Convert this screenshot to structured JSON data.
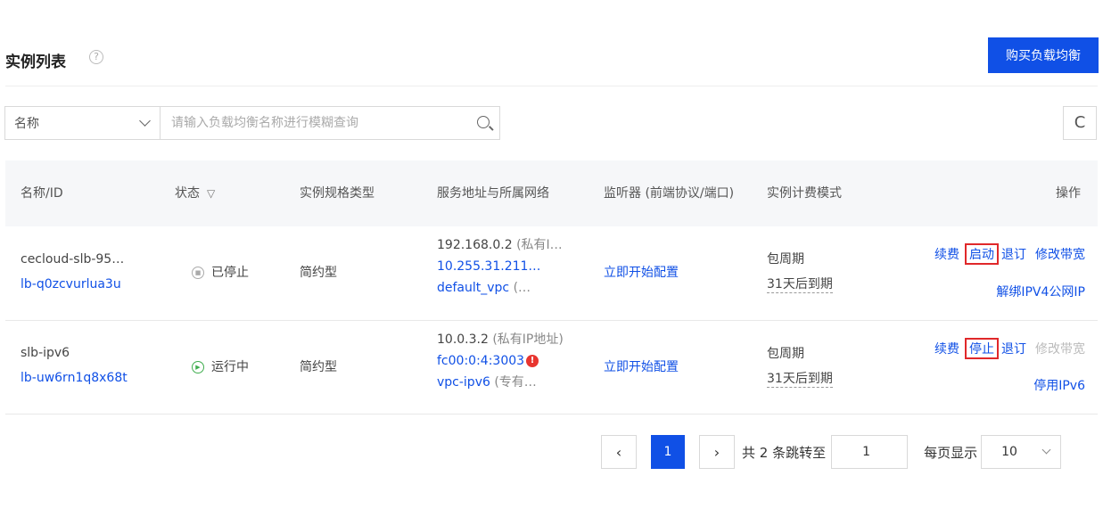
{
  "header": {
    "title": "实例列表",
    "help_icon": "?",
    "buy_button": "购买负载均衡"
  },
  "filter": {
    "select_value": "名称",
    "search_placeholder": "请输入负载均衡名称进行模糊查询",
    "refresh_icon": "C"
  },
  "table": {
    "columns": {
      "name": "名称/ID",
      "status": "状态",
      "spec": "实例规格类型",
      "address": "服务地址与所属网络",
      "listener": "监听器 (前端协议/端口)",
      "billing": "实例计费模式",
      "ops": "操作"
    },
    "rows": [
      {
        "name": "cecloud-slb-95…",
        "id": "lb-q0zcvurlua3u",
        "status": "已停止",
        "spec": "简约型",
        "addr1_ip": "192.168.0.2",
        "addr1_note": "(私有I…",
        "addr2_ip": "10.255.31.211…",
        "addr3_vpc": "default_vpc",
        "addr3_note": "(…",
        "listener": "立即开始配置",
        "billing": "包周期",
        "expiry": "31天后到期",
        "op_renew": "续费",
        "op_toggle": "启动",
        "op_unsubscribe": "退订",
        "op_bandwidth": "修改带宽",
        "op_extra": "解绑IPV4公网IP"
      },
      {
        "name": "slb-ipv6",
        "id": "lb-uw6rn1q8x68t",
        "status": "运行中",
        "spec": "简约型",
        "addr1_ip": "10.0.3.2",
        "addr1_note": "(私有IP地址)",
        "addr2_ip": "fc00:0:4:3003",
        "addr3_vpc": "vpc-ipv6",
        "addr3_note": "(专有…",
        "listener": "立即开始配置",
        "billing": "包周期",
        "expiry": "31天后到期",
        "op_renew": "续费",
        "op_toggle": "停止",
        "op_unsubscribe": "退订",
        "op_bandwidth": "修改带宽",
        "op_extra": "停用IPv6"
      }
    ]
  },
  "pagination": {
    "prev": "‹",
    "page": "1",
    "next": "›",
    "total_text": "共 2 条跳转至",
    "jump_value": "1",
    "per_page_label": "每页显示",
    "per_page_value": "10"
  },
  "colors": {
    "primary": "#1050e6",
    "highlight": "#e0282a",
    "running": "#3fad4e"
  }
}
